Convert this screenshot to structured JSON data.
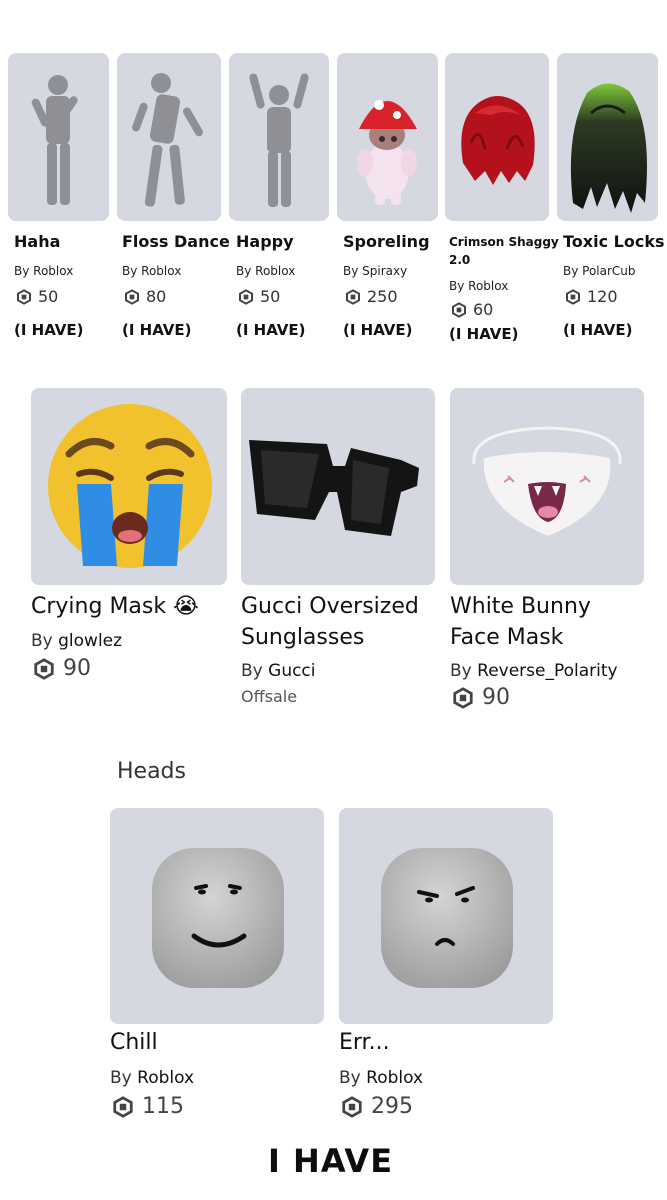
{
  "emotes_row": [
    {
      "name": "Haha",
      "creator": "By Roblox",
      "price": "50",
      "status": "(I HAVE)"
    },
    {
      "name": "Floss Dance",
      "creator": "By Roblox",
      "price": "80",
      "status": "(I HAVE)"
    },
    {
      "name": "Happy",
      "creator": "By Roblox",
      "price": "50",
      "status": "(I HAVE)"
    },
    {
      "name": "Sporeling",
      "creator": "By Spiraxy",
      "price": "250",
      "status": "(I HAVE)"
    },
    {
      "name_line1": "Crimson Shaggy",
      "name_line2": "2.0",
      "creator": "By Roblox",
      "price": "60",
      "status": "(I HAVE)"
    },
    {
      "name": "Toxic Locks",
      "creator": "By PolarCub",
      "price": "120",
      "status": "(I HAVE)"
    }
  ],
  "accessories_row": [
    {
      "name": "Crying Mask 😭",
      "by_prefix": "By",
      "creator": "glowlez",
      "price": "90"
    },
    {
      "name_line1": "Gucci Oversized",
      "name_line2": "Sunglasses",
      "by_prefix": "By",
      "creator": "Gucci",
      "status": "Offsale"
    },
    {
      "name_line1": "White Bunny",
      "name_line2": "Face Mask",
      "by_prefix": "By",
      "creator": "Reverse_Polarity",
      "price": "90"
    }
  ],
  "heads_section": {
    "title": "Heads",
    "items": [
      {
        "name": "Chill",
        "by_prefix": "By",
        "creator": "Roblox",
        "price": "115"
      },
      {
        "name": "Err...",
        "by_prefix": "By",
        "creator": "Roblox",
        "price": "295"
      }
    ]
  },
  "footer": "I HAVE",
  "colors": {
    "card_bg": "#d5d8e1",
    "text": "#111111",
    "robux_icon": "#444444"
  }
}
